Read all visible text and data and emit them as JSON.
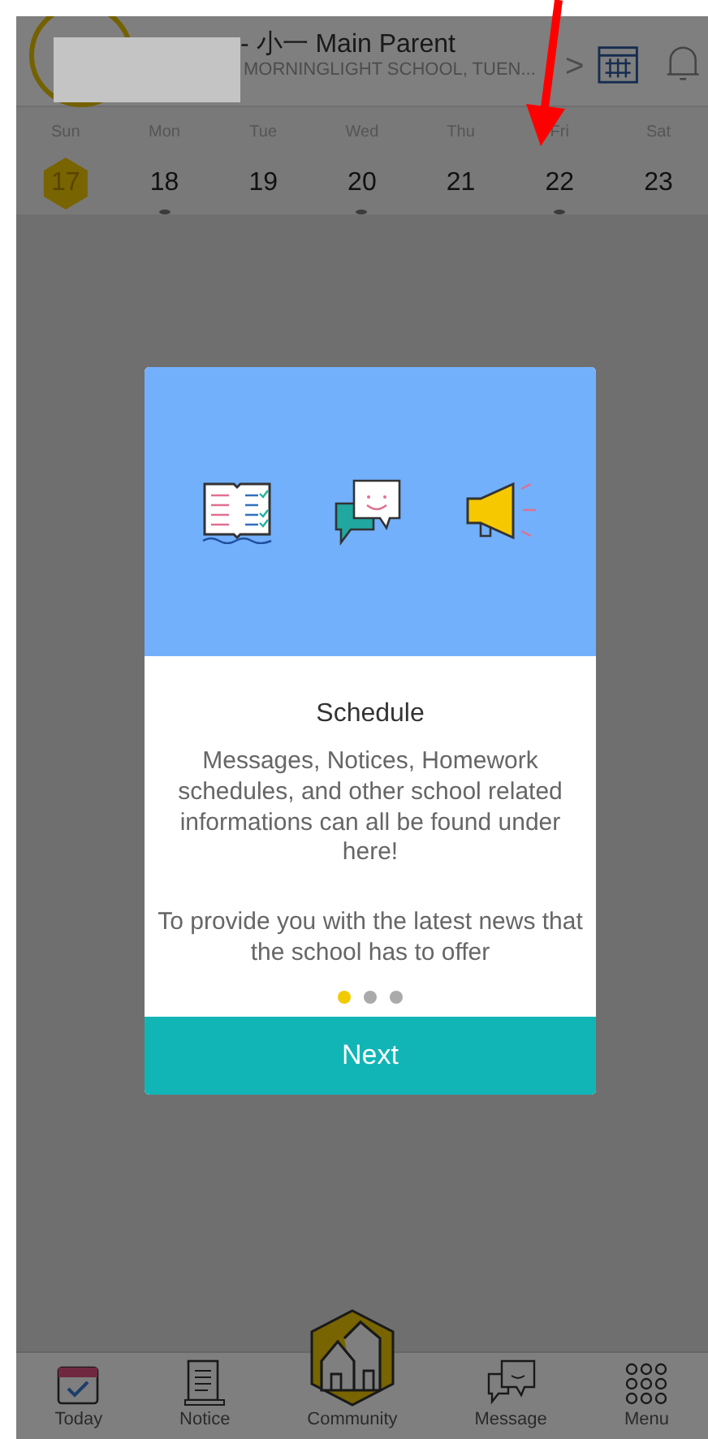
{
  "header": {
    "title": "- 小一  Main Parent",
    "subtitle": "MORNINGLIGHT SCHOOL, TUEN...",
    "chevron": ">"
  },
  "week": [
    {
      "day": "Sun",
      "date": "17",
      "selected": true,
      "has_event": false
    },
    {
      "day": "Mon",
      "date": "18",
      "selected": false,
      "has_event": true
    },
    {
      "day": "Tue",
      "date": "19",
      "selected": false,
      "has_event": false
    },
    {
      "day": "Wed",
      "date": "20",
      "selected": false,
      "has_event": true
    },
    {
      "day": "Thu",
      "date": "21",
      "selected": false,
      "has_event": false
    },
    {
      "day": "Fri",
      "date": "22",
      "selected": false,
      "has_event": true
    },
    {
      "day": "Sat",
      "date": "23",
      "selected": false,
      "has_event": false
    }
  ],
  "dialog": {
    "title": "Schedule",
    "paragraphs": [
      "Messages, Notices, Homework schedules, and other school related informations can all be found under here!",
      "To provide you with the latest news that the school has to offer"
    ],
    "pages": [
      {
        "selected": true
      },
      {
        "selected": false
      },
      {
        "selected": false
      }
    ],
    "button": "Next"
  },
  "tab_bar": [
    {
      "label": "Today",
      "kind": "today"
    },
    {
      "label": "Notice",
      "kind": "notice"
    },
    {
      "label": "Community",
      "kind": "community"
    },
    {
      "label": "Message",
      "kind": "message"
    },
    {
      "label": "Menu",
      "kind": "menu"
    }
  ]
}
